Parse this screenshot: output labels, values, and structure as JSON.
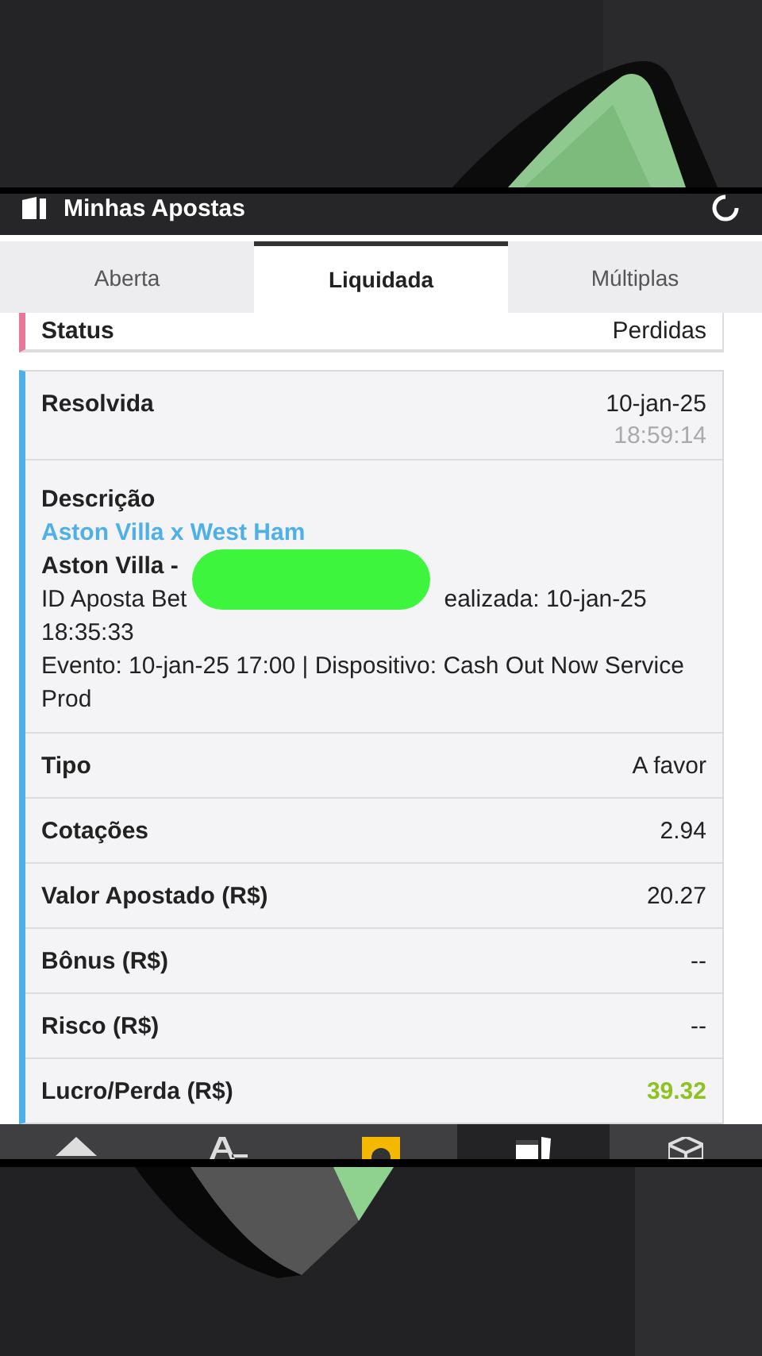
{
  "header": {
    "title": "Minhas Apostas"
  },
  "tabs": [
    {
      "label": "Aberta",
      "selected": false
    },
    {
      "label": "Liquidada",
      "selected": true
    },
    {
      "label": "Múltiplas",
      "selected": false
    }
  ],
  "status": {
    "label": "Status",
    "value": "Perdidas"
  },
  "bet": {
    "resolved_label": "Resolvida",
    "resolved_date": "10-jan-25",
    "resolved_time": "18:59:14",
    "description_label": "Descrição",
    "match_link": "Aston Villa x West Ham",
    "selection": "Aston Villa -",
    "id_start": "ID Aposta Bet",
    "id_end": "ealizada: 10-jan-25",
    "placed_time": "18:35:33",
    "event": "Evento: 10-jan-25 17:00 | Dispositivo: Cash Out Now Service Prod",
    "rows": [
      {
        "label": "Tipo",
        "value": "A favor",
        "kind": "plain"
      },
      {
        "label": "Cotações",
        "value": "2.94",
        "kind": "plain"
      },
      {
        "label": "Valor Apostado (R$)",
        "value": "20.27",
        "kind": "plain"
      },
      {
        "label": "Bônus (R$)",
        "value": "--",
        "kind": "plain"
      },
      {
        "label": "Risco (R$)",
        "value": "--",
        "kind": "plain"
      },
      {
        "label": "Lucro/Perda (R$)",
        "value": "39.32",
        "kind": "gain"
      }
    ]
  },
  "nav": [
    {
      "kind": "up",
      "selected": false
    },
    {
      "kind": "font",
      "selected": false
    },
    {
      "kind": "coin",
      "selected": false
    },
    {
      "kind": "cards",
      "selected": true
    },
    {
      "kind": "cube",
      "selected": false
    }
  ]
}
